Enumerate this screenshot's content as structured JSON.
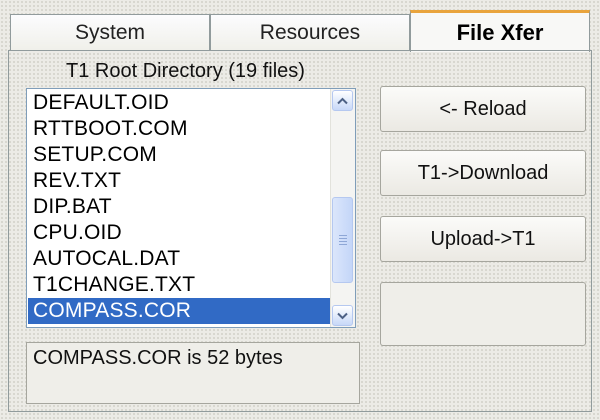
{
  "tabs": [
    {
      "label": "System"
    },
    {
      "label": "Resources"
    },
    {
      "label": "File Xfer",
      "active": true
    }
  ],
  "file_list": {
    "title": "T1 Root Directory (19 files)",
    "items": [
      "DEFAULT.OID",
      "RTTBOOT.COM",
      "SETUP.COM",
      "REV.TXT",
      "DIP.BAT",
      "CPU.OID",
      "AUTOCAL.DAT",
      "T1CHANGE.TXT",
      "COMPASS.COR"
    ],
    "selected": "COMPASS.COR",
    "selection_color": "#316ac5"
  },
  "buttons": {
    "reload": "<- Reload",
    "download": "T1->Download",
    "upload": "Upload->T1"
  },
  "status": "COMPASS.COR is 52 bytes",
  "colors": {
    "active_tab_accent": "#e9a43c",
    "panel_bg": "#ecebe6"
  }
}
